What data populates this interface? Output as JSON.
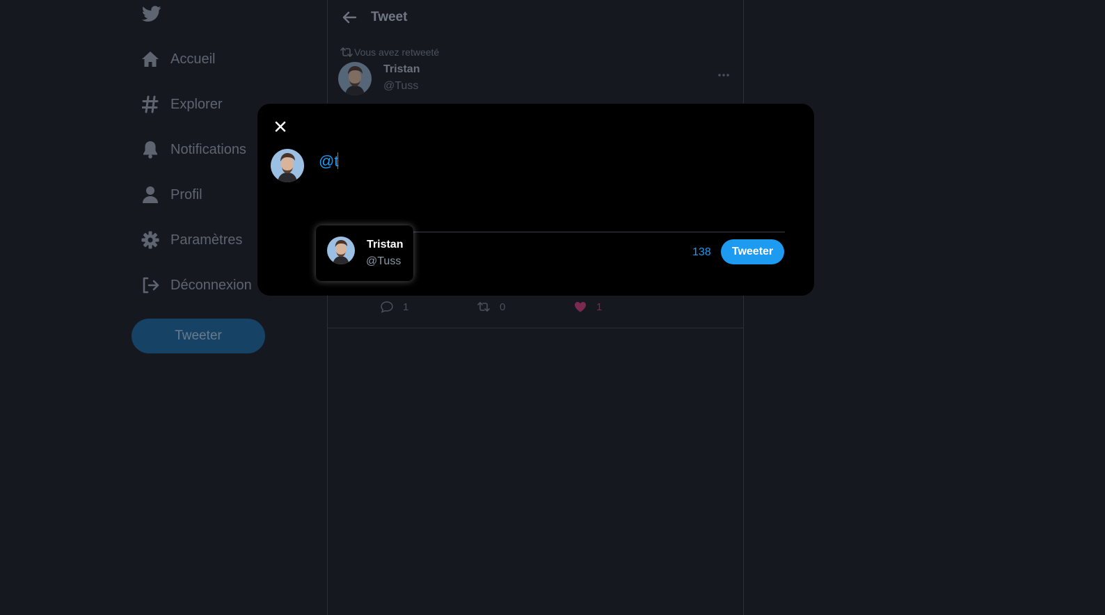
{
  "colors": {
    "accent": "#1d9bf0",
    "background": "#15181e",
    "modal": "#000000",
    "like": "#f91880"
  },
  "sidebar": {
    "logo_icon": "twitter-bird-icon",
    "items": [
      {
        "label": "Accueil",
        "icon": "home-icon"
      },
      {
        "label": "Explorer",
        "icon": "hashtag-icon"
      },
      {
        "label": "Notifications",
        "icon": "bell-icon"
      },
      {
        "label": "Profil",
        "icon": "user-icon"
      },
      {
        "label": "Paramètres",
        "icon": "gear-icon"
      },
      {
        "label": "Déconnexion",
        "icon": "logout-icon"
      }
    ],
    "tweet_button": "Tweeter"
  },
  "main": {
    "title": "Tweet",
    "retweet_note": "Vous avez retweeté",
    "post": {
      "name": "Tristan",
      "handle": "@Tuss"
    },
    "actions": {
      "replies": "1",
      "retweets": "0",
      "likes": "1"
    }
  },
  "compose": {
    "text": "@t",
    "char_count": "138",
    "tweet_button": "Tweeter"
  },
  "suggestion": {
    "name": "Tristan",
    "handle": "@Tuss"
  }
}
